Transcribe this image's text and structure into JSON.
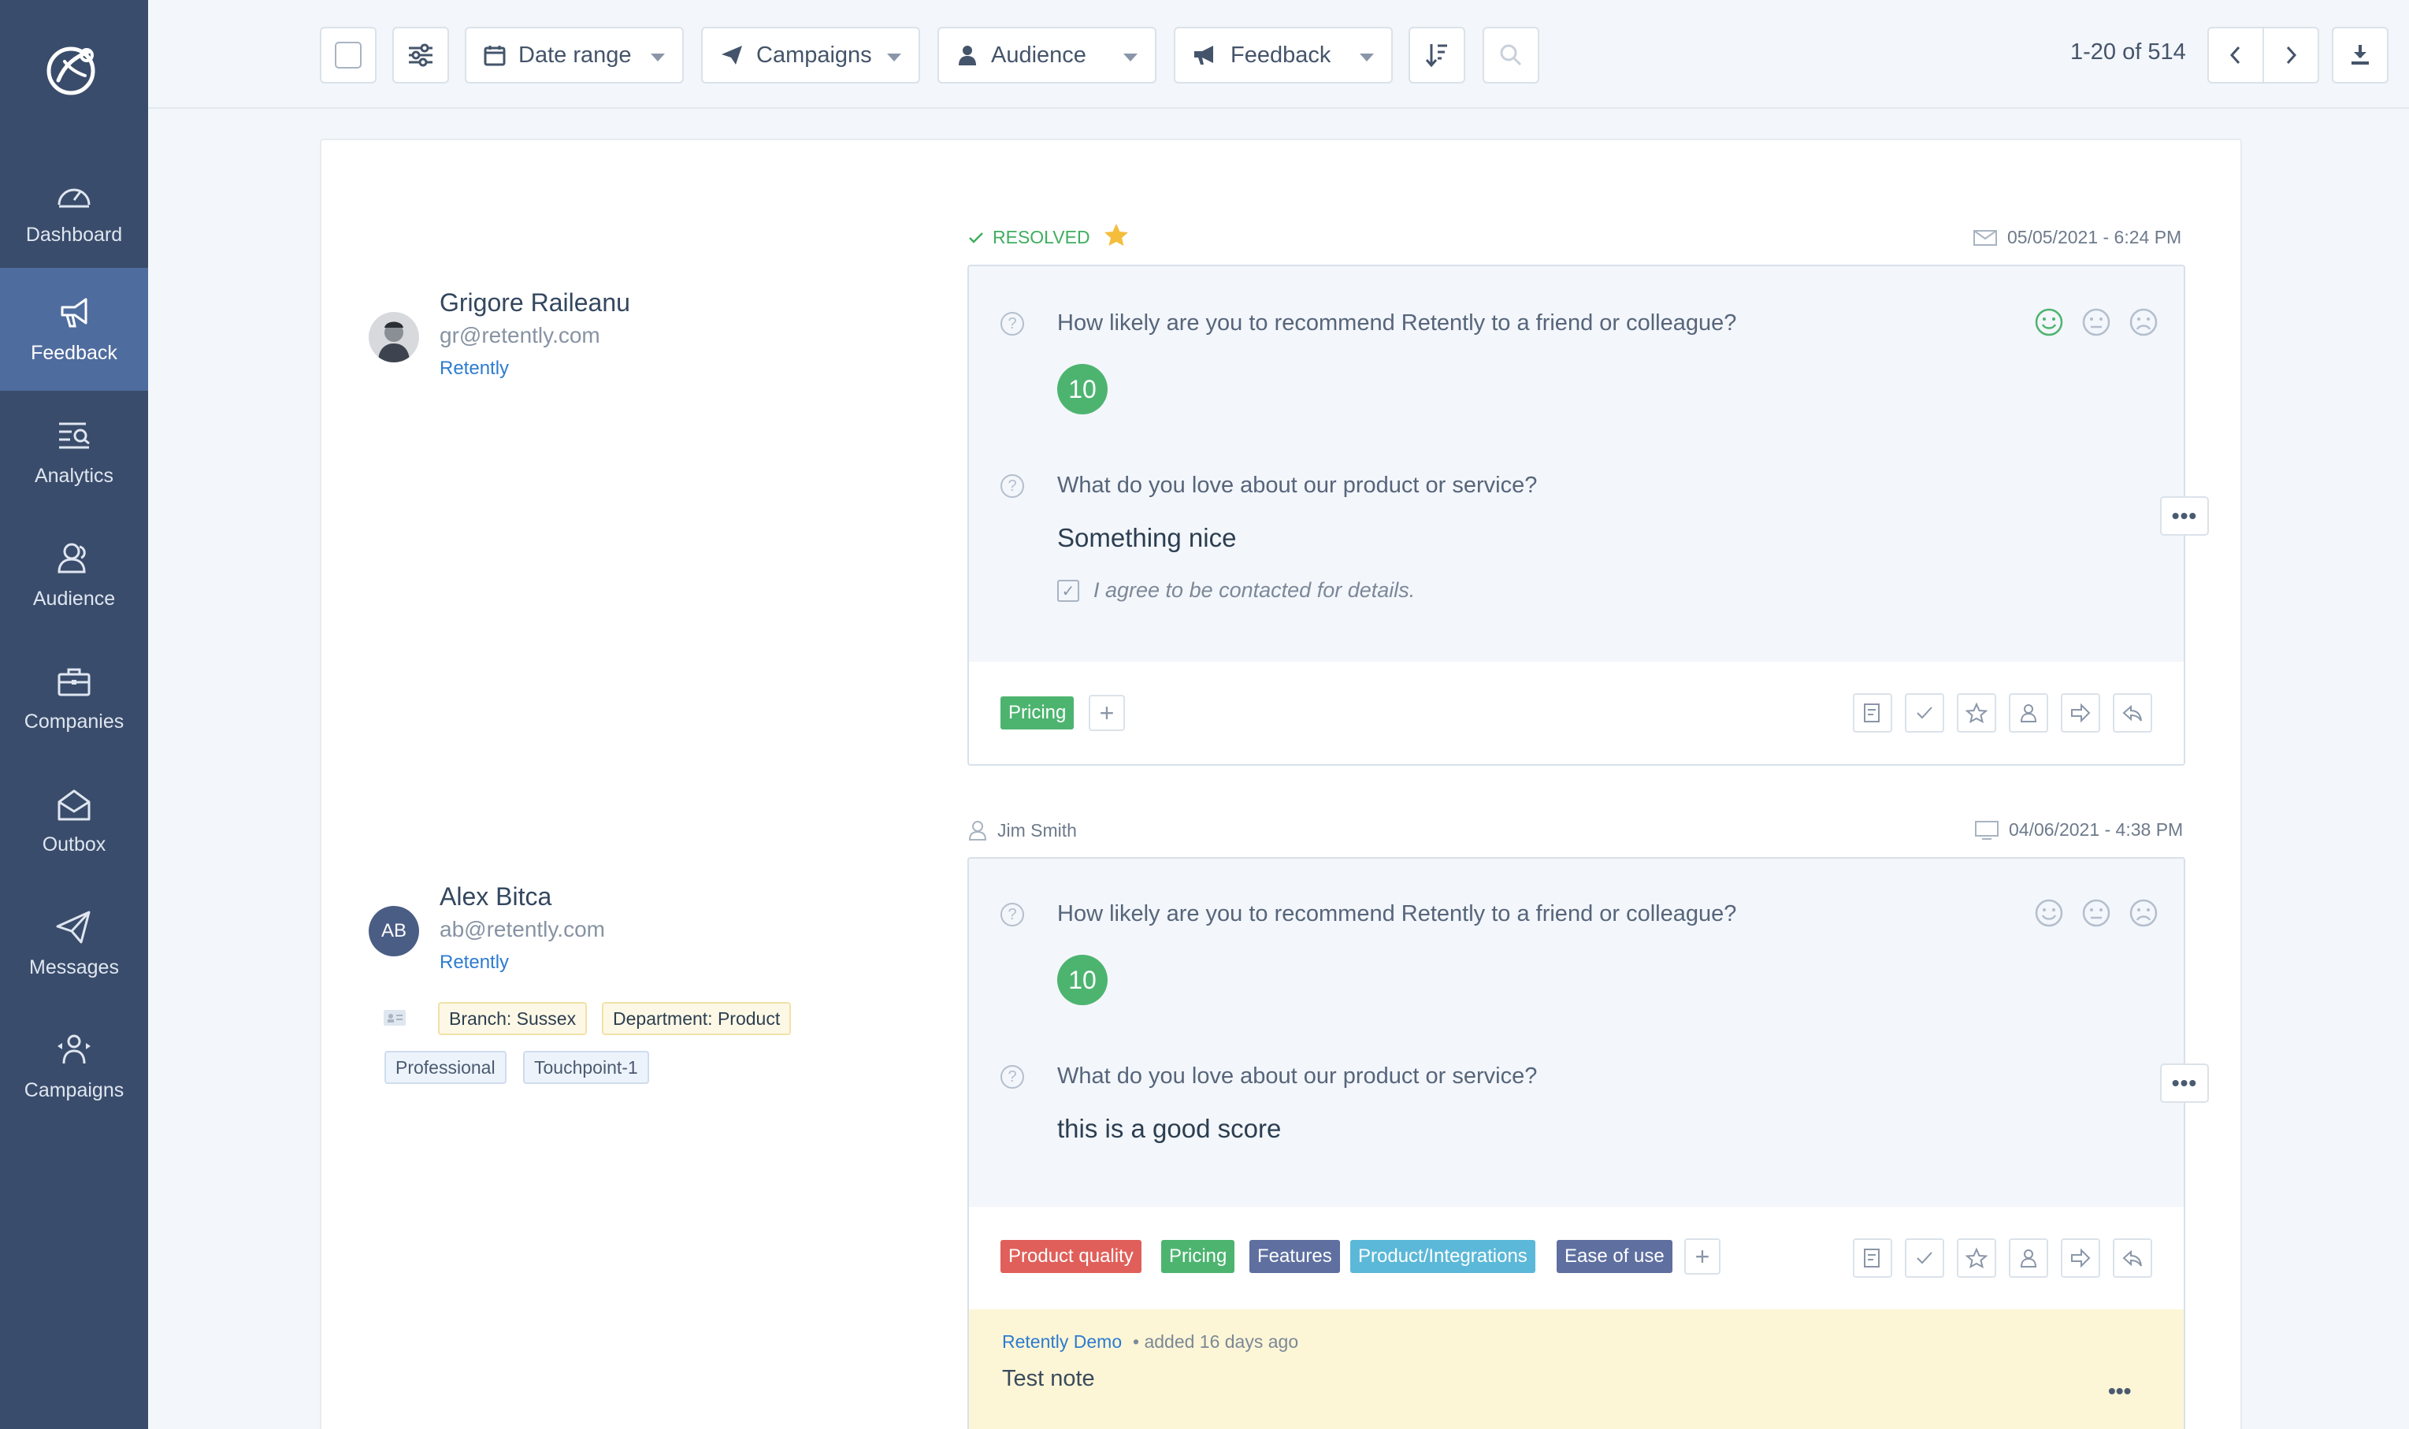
{
  "sidebar": {
    "items": [
      {
        "label": "Dashboard",
        "icon": "dashboard-icon"
      },
      {
        "label": "Feedback",
        "icon": "megaphone-icon",
        "active": true
      },
      {
        "label": "Analytics",
        "icon": "analytics-icon"
      },
      {
        "label": "Audience",
        "icon": "audience-icon"
      },
      {
        "label": "Companies",
        "icon": "briefcase-icon"
      },
      {
        "label": "Outbox",
        "icon": "envelope-open-icon"
      },
      {
        "label": "Messages",
        "icon": "paper-plane-icon"
      },
      {
        "label": "Campaigns",
        "icon": "campaigns-icon"
      }
    ]
  },
  "toolbar": {
    "date_range": "Date range",
    "campaigns": "Campaigns",
    "audience": "Audience",
    "feedback": "Feedback",
    "pagination": "1-20 of 514"
  },
  "responses": [
    {
      "name": "Grigore Raileanu",
      "email": "gr@retently.com",
      "company": "Retently",
      "status": "RESOLVED",
      "date": "05/05/2021 - 6:24 PM",
      "q1": "How likely are you to recommend Retently to a friend or colleague?",
      "score": "10",
      "q2": "What do you love about our product or service?",
      "answer": "Something nice",
      "agree": "I agree to be contacted for details.",
      "tags": [
        {
          "label": "Pricing",
          "color": "#4db470"
        }
      ]
    },
    {
      "name": "Alex Bitca",
      "initials": "AB",
      "email": "ab@retently.com",
      "company": "Retently",
      "assignee": "Jim Smith",
      "date": "04/06/2021 - 4:38 PM",
      "attributes": {
        "branch_key": "Branch:",
        "branch_val": "Sussex",
        "dept_key": "Department:",
        "dept_val": "Product"
      },
      "segments": [
        "Professional",
        "Touchpoint-1"
      ],
      "q1": "How likely are you to recommend Retently to a friend or colleague?",
      "score": "10",
      "q2": "What do you love about our product or service?",
      "answer": "this is a good score",
      "tags": [
        {
          "label": "Product quality",
          "color": "#e05f5a"
        },
        {
          "label": "Pricing",
          "color": "#4db470"
        },
        {
          "label": "Features",
          "color": "#5e6fa0"
        },
        {
          "label": "Product/Integrations",
          "color": "#5bb8d8"
        },
        {
          "label": "Ease of use",
          "color": "#5e6fa0"
        }
      ],
      "note": {
        "author": "Retently Demo",
        "added": "• added 16 days ago",
        "text": "Test note"
      }
    }
  ],
  "colors": {
    "sidebar": "#3a4c6b",
    "sidebar_active": "#4f6c9e",
    "accent_green": "#4db470",
    "link": "#2d7bd0"
  }
}
